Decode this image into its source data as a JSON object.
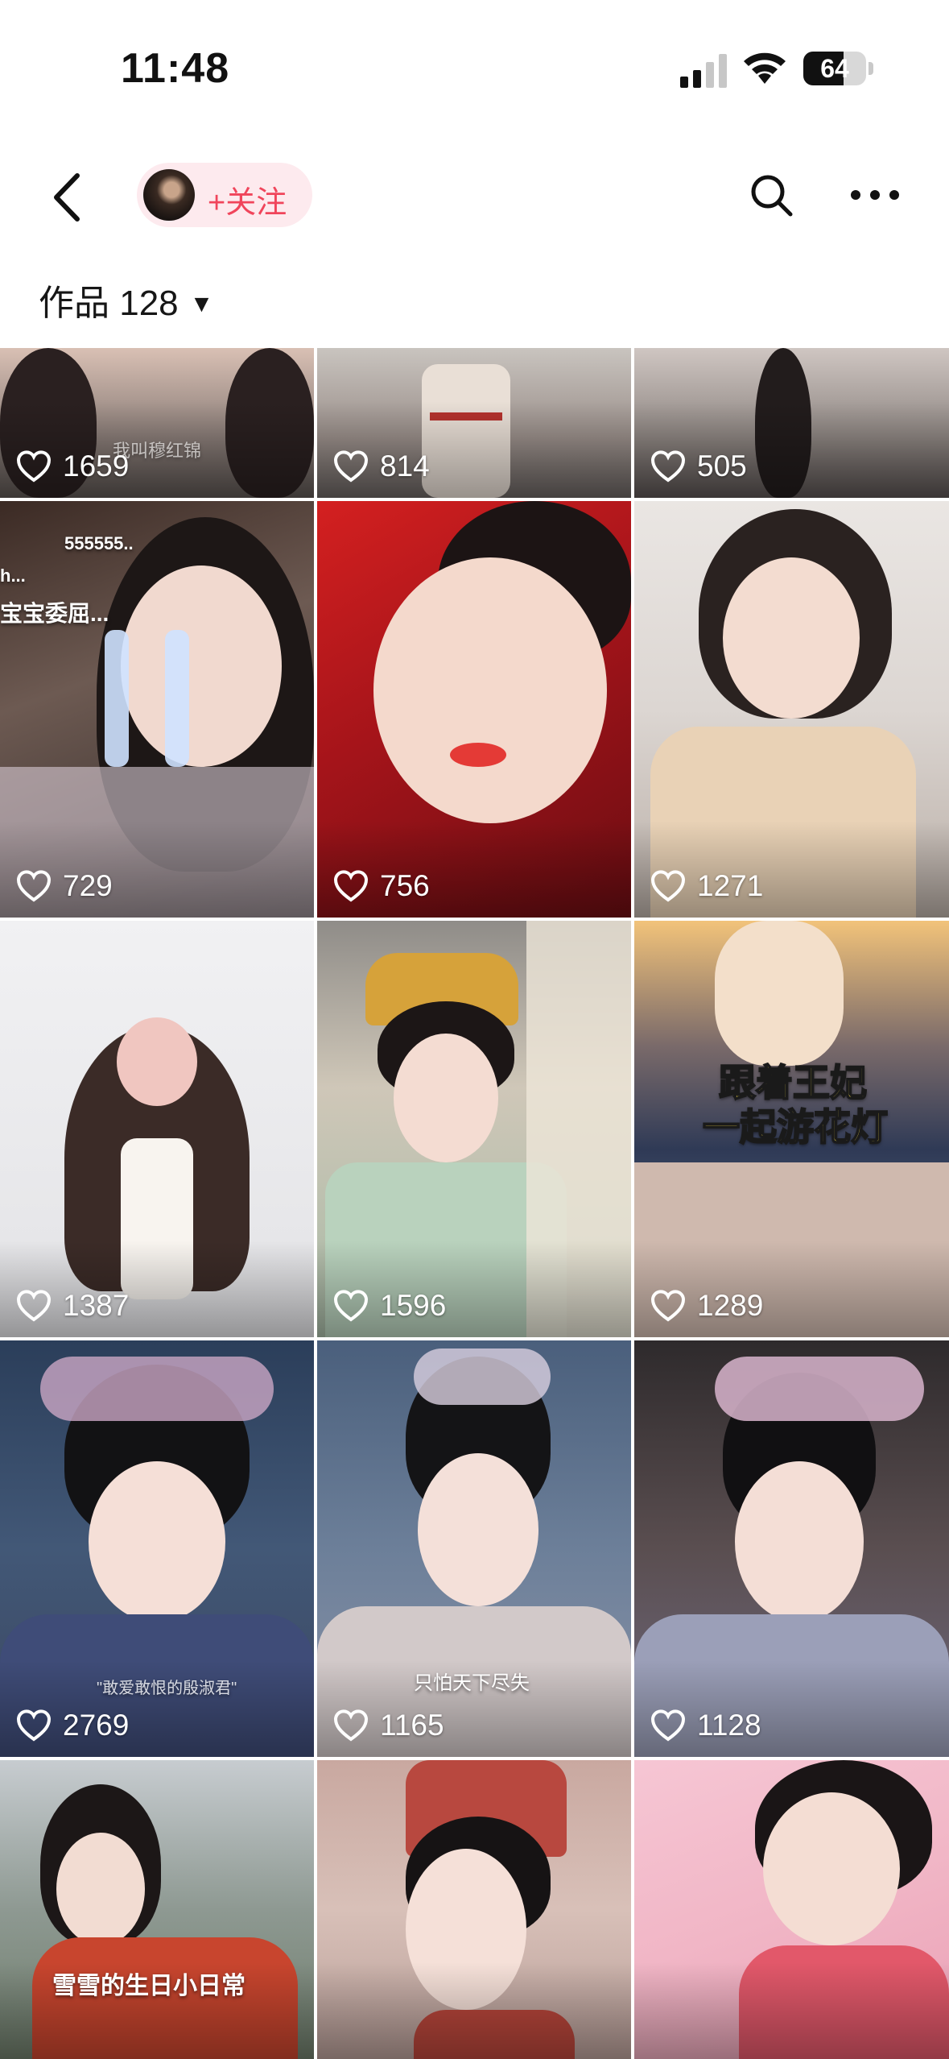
{
  "status_bar": {
    "time": "11:48",
    "battery": "64",
    "battery_level": 0.64
  },
  "nav": {
    "follow_label": "+关注"
  },
  "tab": {
    "works_label": "作品 128"
  },
  "grid": {
    "likes": [
      "1659",
      "814",
      "505",
      "729",
      "756",
      "1271",
      "1387",
      "1596",
      "1289",
      "2769",
      "1165",
      "1128"
    ],
    "captions": {
      "r0c0": "我叫穆红锦",
      "r1c0_top": "555555..",
      "r1c0_line": "宝宝委屈...",
      "r1c0_dots": "h...",
      "r2c2_line1": "跟着王妃",
      "r2c2_line2": "一起游花灯",
      "r3c0": "\"敢爱敢恨的殷淑君\"",
      "r3c1": "只怕天下尽失",
      "r4c0": "雪雪的生日小日常"
    }
  },
  "colors": {
    "accent": "#f0455b",
    "chip_bg": "#fdeaee"
  },
  "icons": [
    "back-chevron-icon",
    "search-icon",
    "more-icon",
    "heart-icon",
    "dropdown-caret-icon",
    "cellular-signal-icon",
    "wifi-icon",
    "battery-icon"
  ]
}
